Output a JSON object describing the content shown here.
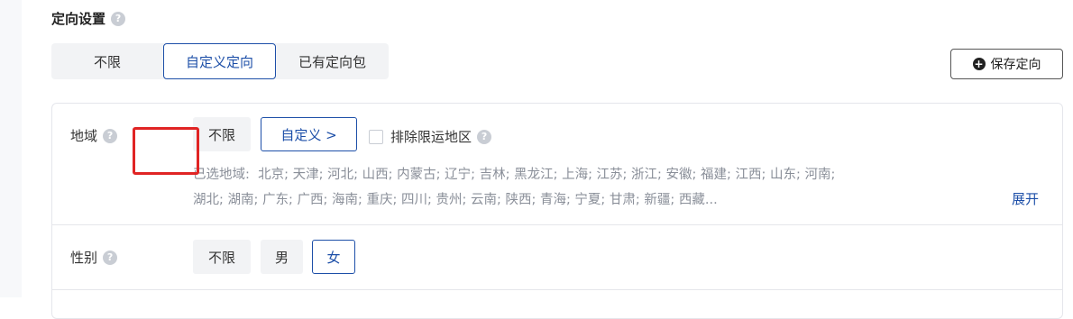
{
  "section": {
    "title": "定向设置"
  },
  "targeting_modes": {
    "options": [
      "不限",
      "自定义定向",
      "已有定向包"
    ],
    "selected": "自定义定向"
  },
  "save_button": {
    "label": "保存定向",
    "icon": "plus-circle-icon"
  },
  "region": {
    "label": "地域",
    "unlimited": "不限",
    "custom": "自定义 >",
    "exclude_label": "排除限运地区",
    "exclude_checked": false,
    "selected_prefix": "已选地域:",
    "selected_line1": "北京; 天津; 河北; 山西; 内蒙古; 辽宁; 吉林; 黑龙江; 上海; 江苏; 浙江; 安徽; 福建; 江西; 山东; 河南;",
    "selected_line2": "湖北; 湖南; 广东; 广西; 海南; 重庆; 四川; 贵州; 云南; 陕西; 青海; 宁夏; 甘肃; 新疆; 西藏...",
    "expand": "展开"
  },
  "gender": {
    "label": "性别",
    "options": [
      "不限",
      "男",
      "女"
    ],
    "selected": "女"
  },
  "colors": {
    "accent": "#1d4fa8",
    "highlight": "#e02424"
  }
}
